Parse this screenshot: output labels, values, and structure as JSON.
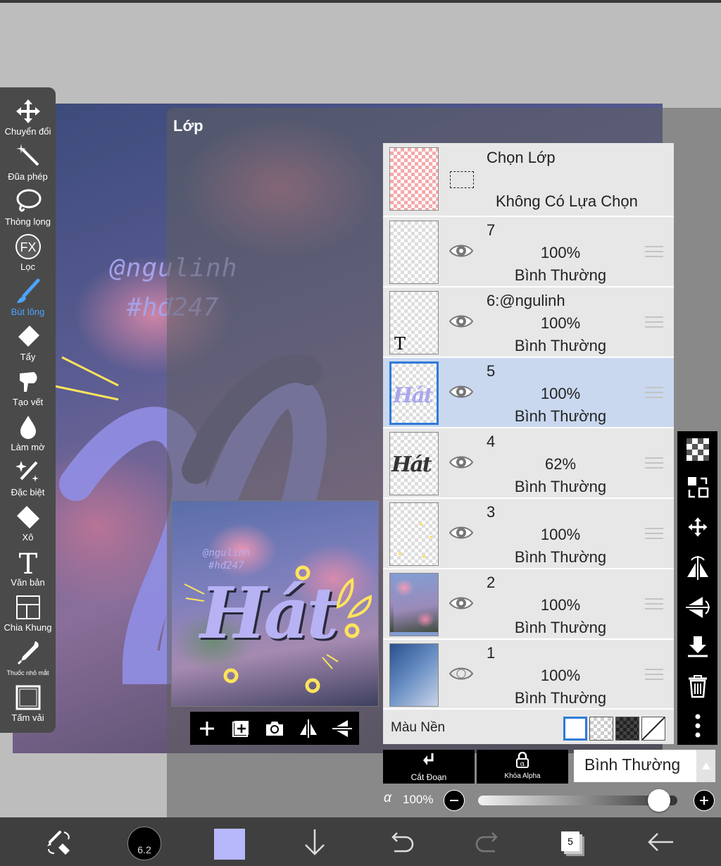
{
  "toolbar": {
    "tools": [
      {
        "label": "Chuyển đổi",
        "icon": "move-icon"
      },
      {
        "label": "Đũa phép",
        "icon": "magic-wand-icon"
      },
      {
        "label": "Thòng lọng",
        "icon": "lasso-icon"
      },
      {
        "label": "Lọc",
        "icon": "fx-filter-icon"
      },
      {
        "label": "Bút lông",
        "icon": "brush-icon",
        "active": true
      },
      {
        "label": "Tẩy",
        "icon": "eraser-icon"
      },
      {
        "label": "Tạo vết",
        "icon": "smudge-icon"
      },
      {
        "label": "Làm mờ",
        "icon": "blur-icon"
      },
      {
        "label": "Đặc biệt",
        "icon": "special-brush-icon"
      },
      {
        "label": "Xô",
        "icon": "bucket-icon"
      },
      {
        "label": "Văn bản",
        "icon": "text-icon"
      },
      {
        "label": "Chia Khung",
        "icon": "frame-divider-icon"
      },
      {
        "label": "Thuốc nhỏ mắt",
        "icon": "eyedropper-icon"
      },
      {
        "label": "Tấm vải",
        "icon": "canvas-icon"
      }
    ]
  },
  "canvas": {
    "watermark_line1": "@ngulinh",
    "watermark_line2": "#hđ247"
  },
  "layer_panel": {
    "title": "Lớp",
    "preview": {
      "watermark_line1": "@ngulinh",
      "watermark_line2": "#hđ247",
      "art_text": "Hát"
    },
    "selection_row": {
      "title": "Chọn Lớp",
      "status": "Không Có Lựa Chọn"
    },
    "layers": [
      {
        "name": "7",
        "opacity": "100%",
        "blend": "Bình Thường",
        "visible": true,
        "selected": false,
        "thumb": "empty"
      },
      {
        "name": "6:@ngulinh",
        "opacity": "100%",
        "blend": "Bình Thường",
        "visible": true,
        "selected": false,
        "thumb": "text",
        "thumb_text": "T"
      },
      {
        "name": "5",
        "opacity": "100%",
        "blend": "Bình Thường",
        "visible": true,
        "selected": true,
        "thumb": "art-lilac",
        "thumb_text": "Hát"
      },
      {
        "name": "4",
        "opacity": "62%",
        "blend": "Bình Thường",
        "visible": true,
        "selected": false,
        "thumb": "art-dark",
        "thumb_text": "Hát"
      },
      {
        "name": "3",
        "opacity": "100%",
        "blend": "Bình Thường",
        "visible": true,
        "selected": false,
        "thumb": "sparkles"
      },
      {
        "name": "2",
        "opacity": "100%",
        "blend": "Bình Thường",
        "visible": true,
        "selected": false,
        "thumb": "photo-flowers"
      },
      {
        "name": "1",
        "opacity": "100%",
        "blend": "Bình Thường",
        "visible": false,
        "selected": false,
        "thumb": "photo-screens"
      }
    ],
    "background_label": "Màu Nền",
    "controls": {
      "clipping_label": "Cắt Đoạn",
      "alpha_lock_label": "Khóa Alpha",
      "blend_mode": "Bình Thường",
      "alpha_symbol": "α",
      "opacity_value": "100%",
      "opacity_fraction": 1.0
    }
  },
  "bottom_bar": {
    "brush_size": "6.2",
    "current_color": "#b7b7fb",
    "layer_count": "5"
  },
  "colors": {
    "accent_blue": "#2f7ad8",
    "selected_row": "#c9d8ef",
    "toolbar_bg": "#4a4a4a",
    "bottom_bar_bg": "#3f3f3f"
  }
}
